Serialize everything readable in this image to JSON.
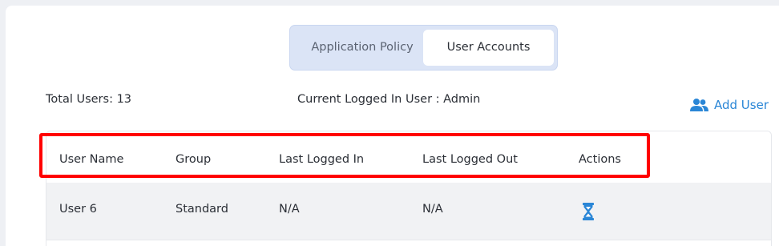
{
  "tabs": {
    "application_policy": "Application Policy",
    "user_accounts": "User Accounts",
    "active": "User Accounts"
  },
  "summary": {
    "total_users": "Total Users: 13",
    "current_user": "Current Logged In User : Admin"
  },
  "add_user": {
    "label": "Add User",
    "icon": "add-user-icon"
  },
  "table": {
    "headers": [
      "User Name",
      "Group",
      "Last Logged In",
      "Last Logged Out",
      "Actions"
    ],
    "rows": [
      {
        "user_name": "User 6",
        "group": "Standard",
        "last_logged_in": "N/A",
        "last_logged_out": "N/A",
        "action_icon": "hourglass-icon"
      }
    ]
  },
  "colors": {
    "accent": "#2a86d6",
    "highlight": "#ff0000",
    "tab_bar": "#dbe4f6",
    "row_bg": "#f1f2f4"
  }
}
